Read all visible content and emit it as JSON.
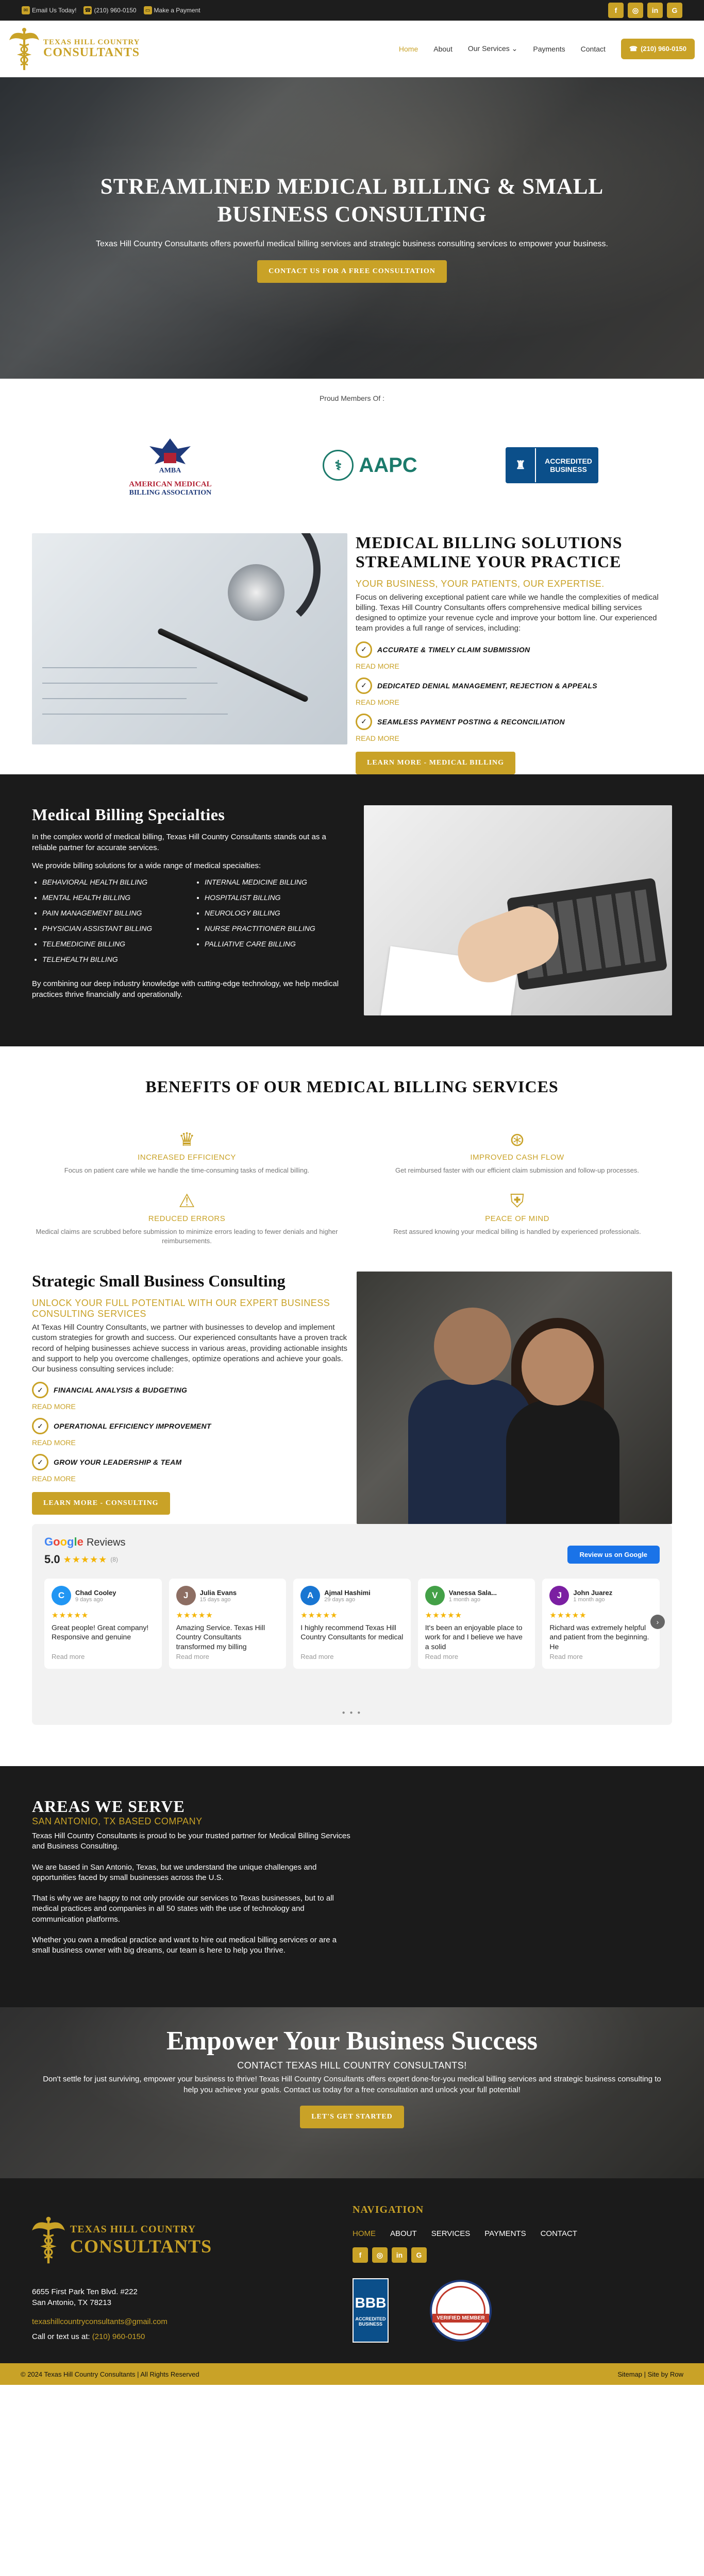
{
  "topbar": {
    "email_label": "Email Us Today!",
    "phone": "(210) 960-0150",
    "payments_label": "Make a Payment",
    "social": [
      "f",
      "ig",
      "in",
      "g"
    ]
  },
  "header": {
    "logo_line1": "TEXAS HILL COUNTRY",
    "logo_line2": "CONSULTANTS",
    "nav": [
      "Home",
      "About",
      "Our Services",
      "Payments",
      "Contact"
    ],
    "call_label": "(210) 960-0150"
  },
  "hero": {
    "title": "STREAMLINED MEDICAL BILLING & SMALL BUSINESS CONSULTING",
    "subtitle": "Texas Hill Country Consultants offers powerful medical billing services and strategic business consulting services to empower your business.",
    "cta": "CONTACT US FOR A FREE CONSULTATION"
  },
  "members": {
    "label": "Proud Members Of :",
    "amba_line1": "AMERICAN MEDICAL",
    "amba_line2": "BILLING ASSOCIATION",
    "amba_abbr": "AMBA",
    "aapc": "AAPC",
    "bbb_line1": "ACCREDITED",
    "bbb_line2": "BUSINESS"
  },
  "billing": {
    "title": "MEDICAL BILLING SOLUTIONS STREAMLINE YOUR PRACTICE",
    "subtitle": "YOUR BUSINESS, YOUR PATIENTS, OUR EXPERTISE.",
    "body": "Focus on delivering exceptional patient care while we handle the complexities of medical billing. Texas Hill Country Consultants offers comprehensive medical billing services designed to optimize your revenue cycle and improve your bottom line. Our experienced team provides a full range of services, including:",
    "features": [
      {
        "title": "ACCURATE & TIMELY CLAIM SUBMISSION",
        "more": "READ MORE"
      },
      {
        "title": "DEDICATED DENIAL MANAGEMENT, REJECTION & APPEALS",
        "more": "READ MORE"
      },
      {
        "title": "SEAMLESS PAYMENT POSTING & RECONCILIATION",
        "more": "READ MORE"
      }
    ],
    "button": "LEARN MORE - MEDICAL BILLING"
  },
  "specialties": {
    "title": "Medical Billing Specialties",
    "intro": "In the complex world of medical billing, Texas Hill Country Consultants stands out as a reliable partner for accurate services.",
    "lead": "We provide billing solutions for a wide range of medical specialties:",
    "col1": [
      "BEHAVIORAL HEALTH BILLING",
      "MENTAL HEALTH BILLING",
      "PAIN MANAGEMENT BILLING",
      "PHYSICIAN ASSISTANT BILLING",
      "TELEMEDICINE BILLING",
      "TELEHEALTH BILLING"
    ],
    "col2": [
      "INTERNAL MEDICINE BILLING",
      "HOSPITALIST BILLING",
      "NEUROLOGY BILLING",
      "NURSE PRACTITIONER BILLING",
      "PALLIATIVE CARE BILLING"
    ],
    "outro": "By combining our deep industry knowledge with cutting-edge technology, we help medical practices thrive financially and operationally."
  },
  "benefits": {
    "title": "BENEFITS OF OUR MEDICAL BILLING SERVICES",
    "items": [
      {
        "title": "INCREASED EFFICIENCY",
        "desc": "Focus on patient care while we handle the time-consuming tasks of medical billing."
      },
      {
        "title": "IMPROVED CASH FLOW",
        "desc": "Get reimbursed faster with our efficient claim submission and follow-up processes."
      },
      {
        "title": "REDUCED ERRORS",
        "desc": "Medical claims are scrubbed before submission to minimize errors leading to fewer denials and higher reimbursements."
      },
      {
        "title": "PEACE OF MIND",
        "desc": "Rest assured knowing your medical billing is handled by experienced professionals."
      }
    ]
  },
  "consulting": {
    "title": "Strategic Small Business Consulting",
    "subtitle": "UNLOCK YOUR FULL POTENTIAL WITH OUR EXPERT BUSINESS CONSULTING SERVICES",
    "body": "At Texas Hill Country Consultants, we partner with businesses to develop and implement custom strategies for growth and success. Our experienced consultants have a proven track record of helping businesses achieve success in various areas, providing actionable insights and support to help you overcome challenges, optimize operations and achieve your goals. Our business consulting services include:",
    "features": [
      {
        "title": "FINANCIAL ANALYSIS & BUDGETING",
        "more": "READ MORE"
      },
      {
        "title": "OPERATIONAL EFFICIENCY IMPROVEMENT",
        "more": "READ MORE"
      },
      {
        "title": "GROW YOUR LEADERSHIP & TEAM",
        "more": "READ MORE"
      }
    ],
    "button": "LEARN MORE - CONSULTING"
  },
  "reviews": {
    "label": "Reviews",
    "rating": "5.0",
    "count": "(8)",
    "button": "Review us on Google",
    "cards": [
      {
        "initial": "C",
        "name": "Chad Cooley",
        "date": "9 days ago",
        "text": "Great people! Great company! Responsive and genuine",
        "color": "#2196f3"
      },
      {
        "initial": "J",
        "name": "Julia Evans",
        "date": "15 days ago",
        "text": "Amazing Service. Texas Hill Country Consultants transformed my billing",
        "color": "#8d6e63"
      },
      {
        "initial": "A",
        "name": "Ajmal Hashimi",
        "date": "29 days ago",
        "text": "I highly recommend Texas Hill Country Consultants for medical",
        "color": "#1976d2"
      },
      {
        "initial": "V",
        "name": "Vanessa Sala...",
        "date": "1 month ago",
        "text": "It's been an enjoyable place to work for and I believe we have a solid",
        "color": "#43a047"
      },
      {
        "initial": "J",
        "name": "John Juarez",
        "date": "1 month ago",
        "text": "Richard was extremely helpful and patient from the beginning. He",
        "color": "#7b1fa2"
      }
    ],
    "read_more": "Read more"
  },
  "areas": {
    "title": "AREAS WE SERVE",
    "subtitle": "SAN ANTONIO, TX BASED COMPANY",
    "p1": "Texas Hill Country Consultants is proud to be your trusted partner for Medical Billing Services and Business Consulting.",
    "p2": "We are based in San Antonio, Texas, but we understand the unique challenges and opportunities faced by small businesses across the U.S.",
    "p3": "That is why we are happy to not only provide our services to Texas businesses, but to all medical practices and companies in all 50 states with the use of technology and communication platforms.",
    "p4": "Whether you own a medical practice and want to hire out medical billing services or are a small business owner with big dreams, our team is here to help you thrive."
  },
  "cta": {
    "title": "Empower Your Business Success",
    "subtitle": "CONTACT TEXAS HILL COUNTRY CONSULTANTS!",
    "body": "Don't settle for just surviving, empower your business to thrive! Texas Hill Country Consultants offers expert done-for-you medical billing services and strategic business consulting to help you achieve your goals. Contact us today for a free consultation and unlock your full potential!",
    "button": "LET'S GET STARTED"
  },
  "footer": {
    "logo_line1": "TEXAS HILL COUNTRY",
    "logo_line2": "CONSULTANTS",
    "address1": "6655 First Park Ten Blvd. #222",
    "address2": "San Antonio, TX 78213",
    "email": "texashillcountryconsultants@gmail.com",
    "call_label": "Call or text us at:",
    "phone": "(210) 960-0150",
    "nav_title": "NAVIGATION",
    "nav": [
      "HOME",
      "ABOUT",
      "SERVICES",
      "PAYMENTS",
      "CONTACT"
    ],
    "bbb_abbr": "BBB",
    "bbb_text": "ACCREDITED BUSINESS",
    "seal_text": "VERIFIED MEMBER"
  },
  "bottom": {
    "copyright": "© 2024 Texas Hill Country Consultants | All Rights Reserved",
    "links": "Sitemap | Site by Row"
  },
  "colors": {
    "accent": "#c9a227",
    "dark": "#1b1b1b"
  }
}
